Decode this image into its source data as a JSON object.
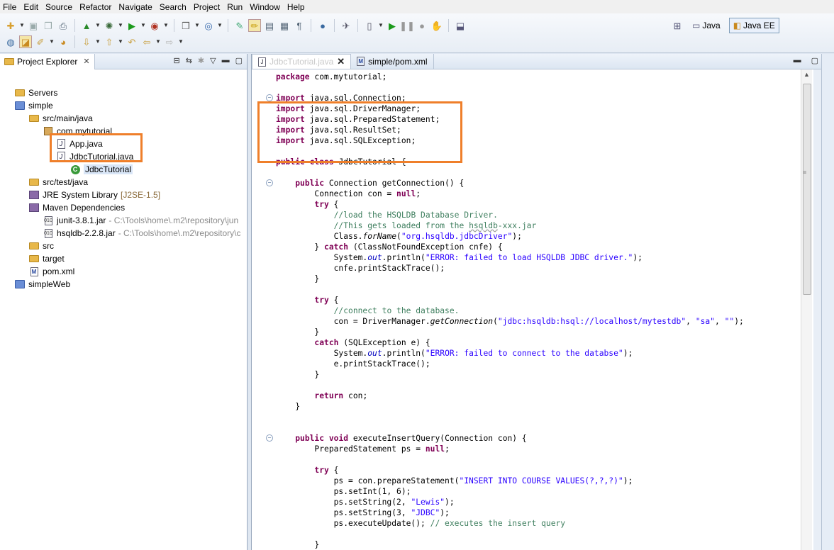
{
  "menu": [
    "File",
    "Edit",
    "Source",
    "Refactor",
    "Navigate",
    "Search",
    "Project",
    "Run",
    "Window",
    "Help"
  ],
  "perspectives": [
    {
      "label": "Java",
      "icon": "java-perspective-icon",
      "active": false
    },
    {
      "label": "Java EE",
      "icon": "javaee-perspective-icon",
      "active": true
    }
  ],
  "explorer": {
    "title": "Project Explorer",
    "tree": [
      {
        "label": "Servers",
        "decoration": "",
        "icon": "folder",
        "level": 1
      },
      {
        "label": "simple",
        "decoration": "",
        "icon": "project",
        "level": 1
      },
      {
        "label": "src/main/java",
        "decoration": "",
        "icon": "folder",
        "level": 2
      },
      {
        "label": "com.mytutorial",
        "decoration": "",
        "icon": "package",
        "level": 3
      },
      {
        "label": "App.java",
        "decoration": "",
        "icon": "java",
        "level": 4
      },
      {
        "label": "JdbcTutorial.java",
        "decoration": "",
        "icon": "java",
        "level": 4
      },
      {
        "label": "JdbcTutorial",
        "decoration": "",
        "icon": "class",
        "level": 5
      },
      {
        "label": "src/test/java",
        "decoration": "",
        "icon": "folder",
        "level": 2
      },
      {
        "label": "JRE System Library",
        "decoration": "[J2SE-1.5]",
        "icon": "library",
        "level": 2
      },
      {
        "label": "Maven Dependencies",
        "decoration": "",
        "icon": "library",
        "level": 2
      },
      {
        "label": "junit-3.8.1.jar",
        "decoration": "- C:\\Tools\\home\\.m2\\repository\\jun",
        "icon": "jar",
        "level": 3
      },
      {
        "label": "hsqldb-2.2.8.jar",
        "decoration": "- C:\\Tools\\home\\.m2\\repository\\c",
        "icon": "jar",
        "level": 3
      },
      {
        "label": "src",
        "decoration": "",
        "icon": "folder",
        "level": 2
      },
      {
        "label": "target",
        "decoration": "",
        "icon": "folder",
        "level": 2
      },
      {
        "label": "pom.xml",
        "decoration": "",
        "icon": "maven",
        "level": 2
      },
      {
        "label": "simpleWeb",
        "decoration": "",
        "icon": "project",
        "level": 1
      }
    ]
  },
  "editor": {
    "tabs": [
      {
        "label": "JdbcTutorial.java",
        "active": true
      },
      {
        "label": "simple/pom.xml",
        "active": false
      }
    ],
    "code": [
      "package com.mytutorial;",
      "",
      "import java.sql.Connection;",
      "import java.sql.DriverManager;",
      "import java.sql.PreparedStatement;",
      "import java.sql.ResultSet;",
      "import java.sql.SQLException;",
      "",
      "public class JdbcTutorial {",
      "",
      "    public Connection getConnection() {",
      "        Connection con = null;",
      "        try {",
      "            //load the HSQLDB Database Driver.",
      "            //This gets loaded from the hsqldb-xxx.jar",
      "            Class.forName(\"org.hsqldb.jdbcDriver\");",
      "        } catch (ClassNotFoundException cnfe) {",
      "            System.out.println(\"ERROR: failed to load HSQLDB JDBC driver.\");",
      "            cnfe.printStackTrace();",
      "        }",
      "",
      "        try {",
      "            //connect to the database.",
      "            con = DriverManager.getConnection(\"jdbc:hsqldb:hsql://localhost/mytestdb\", \"sa\", \"\");",
      "        }",
      "        catch (SQLException e) {",
      "            System.out.println(\"ERROR: failed to connect to the databse\");",
      "            e.printStackTrace();",
      "        }",
      "",
      "        return con;",
      "    }",
      "",
      "",
      "    public void executeInsertQuery(Connection con) {",
      "        PreparedStatement ps = null;",
      "",
      "        try {",
      "            ps = con.prepareStatement(\"INSERT INTO COURSE VALUES(?,?,?)\");",
      "            ps.setInt(1, 6);",
      "            ps.setString(2, \"Lewis\");",
      "            ps.setString(3, \"JDBC\");",
      "            ps.executeUpdate(); // executes the insert query",
      "",
      "        }"
    ]
  }
}
